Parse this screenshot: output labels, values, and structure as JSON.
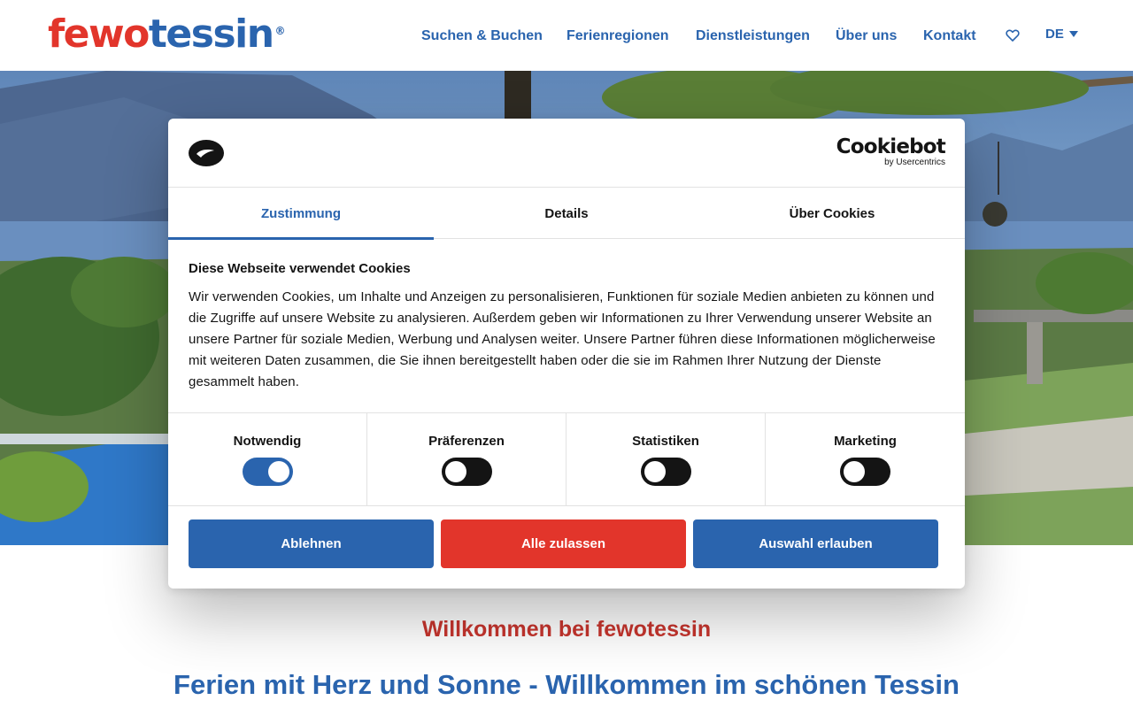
{
  "header": {
    "logo_part1": "fewo",
    "logo_part2": "tessin",
    "logo_reg": "®",
    "nav": [
      "Suchen & Buchen",
      "Ferienregionen",
      "Dienstleistungen",
      "Über uns",
      "Kontakt"
    ],
    "favorites_icon": "heart-icon",
    "language": "DE"
  },
  "cookie_dialog": {
    "brand_name": "Cookiebot",
    "brand_sub": "by Usercentrics",
    "tabs": [
      "Zustimmung",
      "Details",
      "Über Cookies"
    ],
    "active_tab": "Zustimmung",
    "title": "Diese Webseite verwendet Cookies",
    "text": "Wir verwenden Cookies, um Inhalte und Anzeigen zu personalisieren, Funktionen für soziale Medien anbieten zu können und die Zugriffe auf unsere Website zu analysieren. Außerdem geben wir Informationen zu Ihrer Verwendung unserer Website an unsere Partner für soziale Medien, Werbung und Analysen weiter. Unsere Partner führen diese Informationen möglicherweise mit weiteren Daten zusammen, die Sie ihnen bereitgestellt haben oder die sie im Rahmen Ihrer Nutzung der Dienste gesammelt haben.",
    "categories": [
      {
        "label": "Notwendig",
        "enabled": true
      },
      {
        "label": "Präferenzen",
        "enabled": false
      },
      {
        "label": "Statistiken",
        "enabled": false
      },
      {
        "label": "Marketing",
        "enabled": false
      }
    ],
    "buttons": {
      "decline": "Ablehnen",
      "allow_all": "Alle zulassen",
      "allow_selection": "Auswahl erlauben"
    }
  },
  "content": {
    "welcome": "Willkommen bei fewotessin",
    "headline": "Ferien mit Herz und Sonne - Willkommen im schönen Tessin"
  },
  "colors": {
    "brand_blue": "#2a64ae",
    "brand_red": "#e2352b",
    "text_dark": "#141414"
  }
}
